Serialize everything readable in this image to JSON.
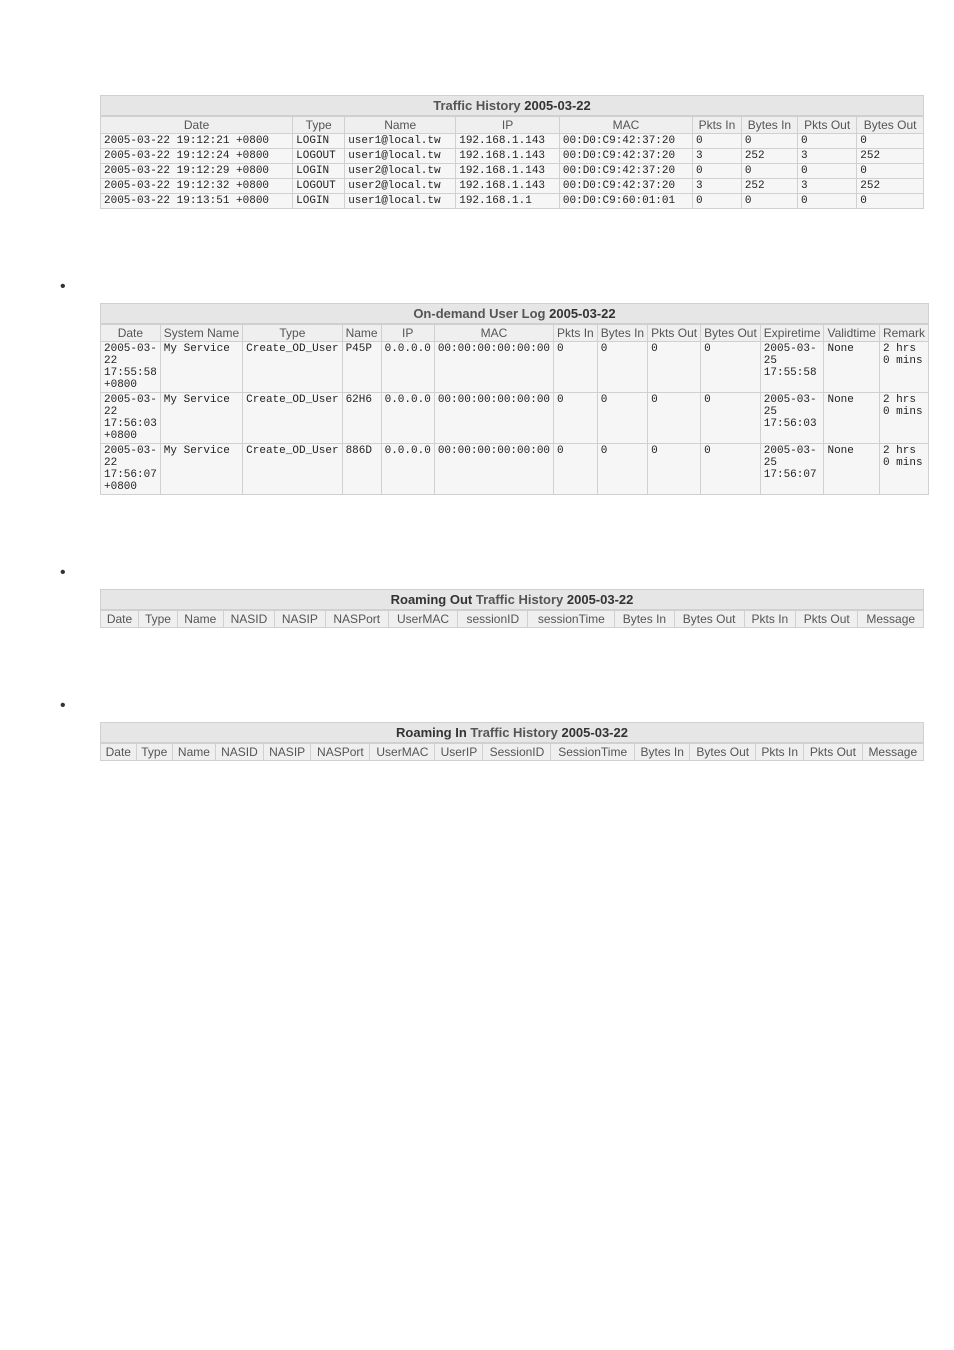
{
  "traffic_history": {
    "title_prefix": "Traffic History",
    "title_date": "2005-03-22",
    "columns": [
      "Date",
      "Type",
      "Name",
      "IP",
      "MAC",
      "Pkts In",
      "Bytes In",
      "Pkts Out",
      "Bytes Out"
    ],
    "rows": [
      [
        "2005-03-22 19:12:21 +0800",
        "LOGIN",
        "user1@local.tw",
        "192.168.1.143",
        "00:D0:C9:42:37:20",
        "0",
        "0",
        "0",
        "0"
      ],
      [
        "2005-03-22 19:12:24 +0800",
        "LOGOUT",
        "user1@local.tw",
        "192.168.1.143",
        "00:D0:C9:42:37:20",
        "3",
        "252",
        "3",
        "252"
      ],
      [
        "2005-03-22 19:12:29 +0800",
        "LOGIN",
        "user2@local.tw",
        "192.168.1.143",
        "00:D0:C9:42:37:20",
        "0",
        "0",
        "0",
        "0"
      ],
      [
        "2005-03-22 19:12:32 +0800",
        "LOGOUT",
        "user2@local.tw",
        "192.168.1.143",
        "00:D0:C9:42:37:20",
        "3",
        "252",
        "3",
        "252"
      ],
      [
        "2005-03-22 19:13:51 +0800",
        "LOGIN",
        "user1@local.tw",
        "192.168.1.1",
        "00:D0:C9:60:01:01",
        "0",
        "0",
        "0",
        "0"
      ]
    ]
  },
  "ondemand_user_log": {
    "title_prefix": "On-demand User Log",
    "title_date": "2005-03-22",
    "columns": [
      "Date",
      "System Name",
      "Type",
      "Name",
      "IP",
      "MAC",
      "Pkts In",
      "Bytes In",
      "Pkts Out",
      "Bytes Out",
      "Expiretime",
      "Validtime",
      "Remark"
    ],
    "rows": [
      [
        "2005-03-22 17:55:58 +0800",
        "My Service",
        "Create_OD_User",
        "P45P",
        "0.0.0.0",
        "00:00:00:00:00:00",
        "0",
        "0",
        "0",
        "0",
        "2005-03-25 17:55:58",
        "None",
        "2 hrs 0 mins"
      ],
      [
        "2005-03-22 17:56:03 +0800",
        "My Service",
        "Create_OD_User",
        "62H6",
        "0.0.0.0",
        "00:00:00:00:00:00",
        "0",
        "0",
        "0",
        "0",
        "2005-03-25 17:56:03",
        "None",
        "2 hrs 0 mins"
      ],
      [
        "2005-03-22 17:56:07 +0800",
        "My Service",
        "Create_OD_User",
        "886D",
        "0.0.0.0",
        "00:00:00:00:00:00",
        "0",
        "0",
        "0",
        "0",
        "2005-03-25 17:56:07",
        "None",
        "2 hrs 0 mins"
      ]
    ]
  },
  "roaming_out": {
    "title_prefix": "Roaming Out",
    "title_mid": "Traffic History",
    "title_date": "2005-03-22",
    "columns": [
      "Date",
      "Type",
      "Name",
      "NASID",
      "NASIP",
      "NASPort",
      "UserMAC",
      "sessionID",
      "sessionTime",
      "Bytes In",
      "Bytes Out",
      "Pkts In",
      "Pkts Out",
      "Message"
    ],
    "rows": []
  },
  "roaming_in": {
    "title_prefix": "Roaming In",
    "title_mid": "Traffic History",
    "title_date": "2005-03-22",
    "columns": [
      "Date",
      "Type",
      "Name",
      "NASID",
      "NASIP",
      "NASPort",
      "UserMAC",
      "UserIP",
      "SessionID",
      "SessionTime",
      "Bytes In",
      "Bytes Out",
      "Pkts In",
      "Pkts Out",
      "Message"
    ],
    "rows": []
  }
}
